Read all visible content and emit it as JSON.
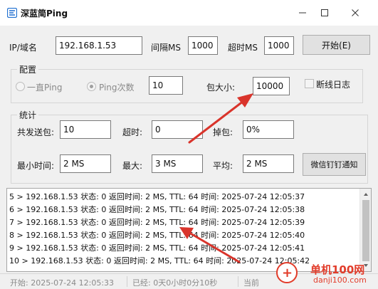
{
  "window": {
    "title": "深蓝简Ping",
    "minimize_glyph": "—",
    "maximize_glyph": "☐",
    "close_glyph": "✕"
  },
  "top": {
    "ip_label": "IP/域名",
    "ip_value": "192.168.1.53",
    "interval_label": "间隔MS",
    "interval_value": "1000",
    "timeout_label": "超时MS",
    "timeout_value": "1000",
    "start_button": "开始(E)"
  },
  "config": {
    "title": "配置",
    "radio_always": "一直Ping",
    "radio_count": "Ping次数",
    "count_value": "10",
    "packet_label": "包大小:",
    "packet_value": "10000",
    "disconnect_log": "断线日志"
  },
  "stats": {
    "title": "统计",
    "sent_label": "共发送包:",
    "sent_value": "10",
    "timeout_label": "超时:",
    "timeout_value": "0",
    "loss_label": "掉包:",
    "loss_value": "0%",
    "min_label": "最小时间:",
    "min_value": "2 MS",
    "max_label": "最大:",
    "max_value": "3 MS",
    "avg_label": "平均:",
    "avg_value": "2 MS",
    "notify_button": "微信钉钉通知"
  },
  "log": {
    "lines": [
      "5 > 192.168.1.53 状态: 0 返回时间: 2 MS, TTL: 64 时间: 2025-07-24 12:05:37",
      "6 > 192.168.1.53 状态: 0 返回时间: 2 MS, TTL: 64 时间: 2025-07-24 12:05:38",
      "7 > 192.168.1.53 状态: 0 返回时间: 2 MS, TTL: 64 时间: 2025-07-24 12:05:39",
      "8 > 192.168.1.53 状态: 0 返回时间: 2 MS, TTL: 64 时间: 2025-07-24 12:05:40",
      "9 > 192.168.1.53 状态: 0 返回时间: 2 MS, TTL: 64 时间: 2025-07-24 12:05:41",
      "10 > 192.168.1.53 状态: 0 返回时间: 2 MS, TTL: 64 时间: 2025-07-24 12:05:42"
    ]
  },
  "status": {
    "start": "开始:  2025-07-24 12:05:33",
    "elapsed": "已经: 0天0小时0分10秒",
    "current": "当前"
  },
  "watermark": {
    "line1": "单机100网",
    "line2": "danji100.com"
  },
  "colors": {
    "annotation_arrow": "#d9342b",
    "watermark": "#e23c2a"
  }
}
